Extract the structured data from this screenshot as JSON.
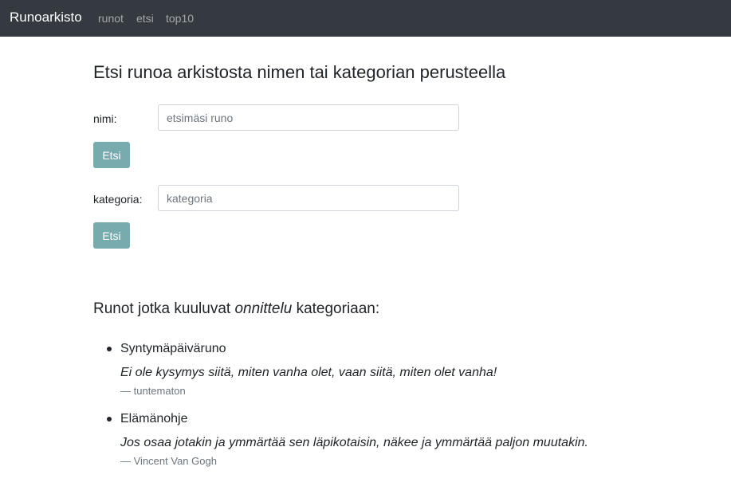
{
  "navbar": {
    "brand": "Runoarkisto",
    "links": [
      "runot",
      "etsi",
      "top10"
    ]
  },
  "search": {
    "title": "Etsi runoa arkistosta nimen tai kategorian perusteella",
    "name_label": "nimi:",
    "name_placeholder": "etsimäsi runo",
    "name_value": "",
    "search_button": "Etsi",
    "category_label": "kategoria:",
    "category_placeholder": "kategoria",
    "category_value": ""
  },
  "results": {
    "heading_prefix": "Runot jotka kuuluvat ",
    "category": "onnittelu",
    "heading_suffix": " kategoriaan:",
    "poems": [
      {
        "title": "Syntymäpäiväruno",
        "text": "Ei ole kysymys siitä, miten vanha olet, vaan siitä, miten olet vanha!",
        "author_prefix": "— ",
        "author": "tuntematon"
      },
      {
        "title": "Elämänohje",
        "text": "Jos osaa jotakin ja ymmärtää sen läpikotaisin, näkee ja ymmärtää paljon muutakin.",
        "author_prefix": "— ",
        "author": "Vincent Van Gogh"
      }
    ]
  },
  "colors": {
    "navbar": "#343a40",
    "button": "#78abae",
    "muted": "#6c757d"
  }
}
